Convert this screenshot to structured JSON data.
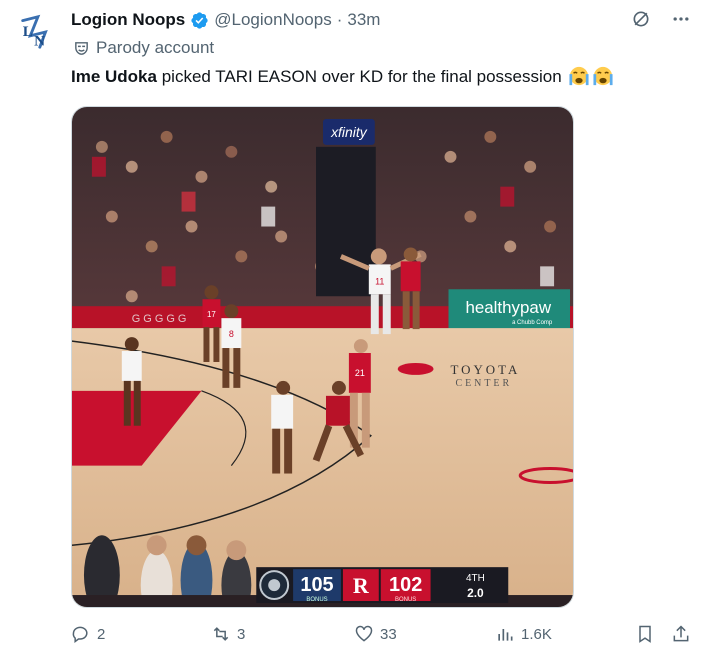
{
  "tweet": {
    "display_name": "Logion Noops",
    "handle": "@LogionNoops",
    "separator": "·",
    "time": "33m",
    "parody_label": "Parody account",
    "text_bold": "Ime Udoka",
    "text_rest": " picked TARI EASON over KD for the final possession"
  },
  "media": {
    "arena_sign": "xfinity",
    "sponsor_sign": "healthypaw",
    "sponsor_sub": "a Chubb Comp",
    "toyota_text": "TOYOTA",
    "center_text": "CENTER",
    "away_jersey_1": "11",
    "away_jersey_2": "8",
    "home_jersey_1": "17",
    "home_jersey_2": "21",
    "scoreboard": {
      "away_score": "105",
      "away_bonus": "BONUS",
      "home_score": "102",
      "home_bonus": "BONUS",
      "period": "4TH",
      "clock": "2.0"
    }
  },
  "actions": {
    "replies": "2",
    "reposts": "3",
    "likes": "33",
    "views": "1.6K"
  },
  "icons": [
    "logo-icon",
    "verified-badge-icon",
    "grok-icon",
    "more-icon",
    "parody-mask-icon",
    "crying-emoji-icon",
    "reply-icon",
    "repost-icon",
    "like-icon",
    "views-icon",
    "bookmark-icon",
    "share-icon"
  ],
  "colors": {
    "verified": "#1d9bf0",
    "secondary_text": "#536471",
    "court_red": "#c8102e"
  }
}
